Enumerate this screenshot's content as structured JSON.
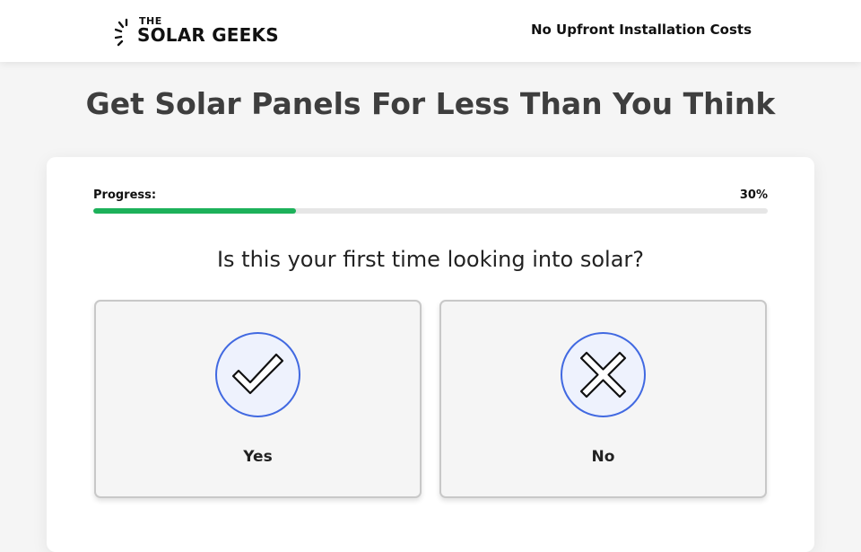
{
  "header": {
    "logo_small": "THE",
    "logo_main": "SOLAR GEEKS",
    "tagline": "No Upfront Installation Costs"
  },
  "headline": "Get Solar Panels For Less Than You Think",
  "progress": {
    "label": "Progress:",
    "value_text": "30%",
    "fraction": 0.3,
    "bar_color": "#1db15a"
  },
  "question": "Is this your first time looking into solar?",
  "options": [
    {
      "label": "Yes",
      "icon": "checkmark-icon"
    },
    {
      "label": "No",
      "icon": "x-icon"
    }
  ],
  "colors": {
    "accent_blue": "#4169e1",
    "headline_gray": "#3e3e3e",
    "background": "#f5f5f5"
  }
}
